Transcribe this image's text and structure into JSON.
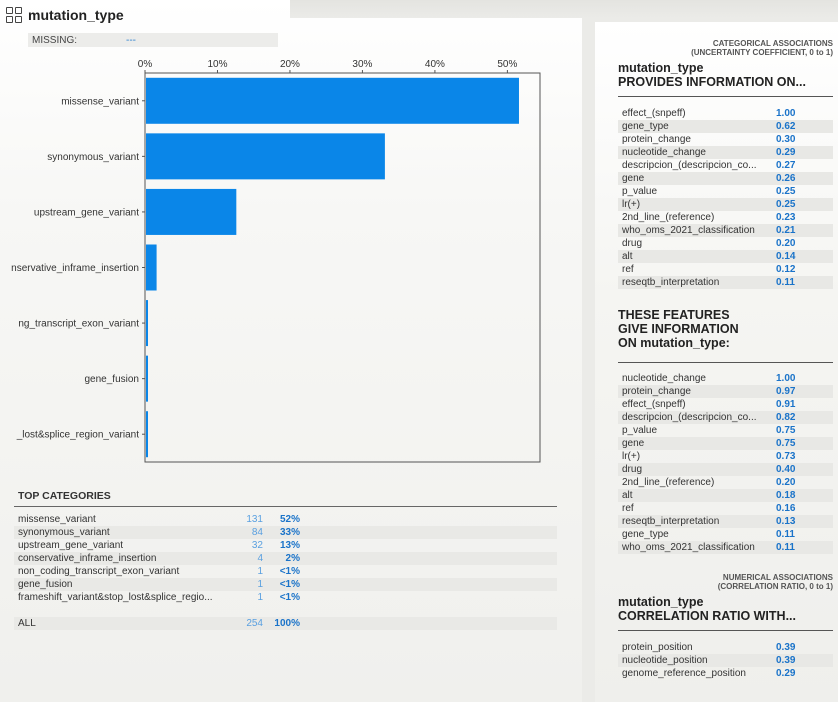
{
  "title": "mutation_type",
  "missing": {
    "label": "MISSING:",
    "value": "---"
  },
  "chart_data": {
    "type": "bar",
    "orientation": "horizontal",
    "categories": [
      "missense_variant",
      "synonymous_variant",
      "upstream_gene_variant",
      "conservative_inframe_insertion",
      "non_coding_transcript_exon_variant",
      "gene_fusion",
      "frameshift_variant&stop_lost&splice_region_variant"
    ],
    "category_labels_visible": [
      "missense_variant",
      "synonymous_variant",
      "upstream_gene_variant",
      "nservative_inframe_insertion",
      "ng_transcript_exon_variant",
      "gene_fusion",
      "_lost&splice_region_variant"
    ],
    "values": [
      51.6,
      33.1,
      12.6,
      1.6,
      0.4,
      0.4,
      0.4
    ],
    "xticks": [
      "0%",
      "10%",
      "20%",
      "30%",
      "40%",
      "50%"
    ],
    "xlim": [
      0,
      54.5
    ],
    "bar_color": "#0a86e8"
  },
  "top_categories": {
    "title": "TOP CATEGORIES",
    "rows": [
      {
        "name": "missense_variant",
        "count": "131",
        "pct": "52%"
      },
      {
        "name": "synonymous_variant",
        "count": "84",
        "pct": "33%"
      },
      {
        "name": "upstream_gene_variant",
        "count": "32",
        "pct": "13%"
      },
      {
        "name": "conservative_inframe_insertion",
        "count": "4",
        "pct": "2%"
      },
      {
        "name": "non_coding_transcript_exon_variant",
        "count": "1",
        "pct": "<1%"
      },
      {
        "name": "gene_fusion",
        "count": "1",
        "pct": "<1%"
      },
      {
        "name": "frameshift_variant&stop_lost&splice_regio...",
        "count": "1",
        "pct": "<1%"
      }
    ],
    "all": {
      "name": "ALL",
      "count": "254",
      "pct": "100%"
    }
  },
  "categorical": {
    "header1": "CATEGORICAL ASSOCIATIONS",
    "header2": "(UNCERTAINTY COEFFICIENT, 0 to 1)",
    "title1": "mutation_type",
    "title2": "PROVIDES INFORMATION ON...",
    "rows": [
      {
        "name": "effect_(snpeff)",
        "val": "1.00"
      },
      {
        "name": "gene_type",
        "val": "0.62"
      },
      {
        "name": "protein_change",
        "val": "0.30"
      },
      {
        "name": "nucleotide_change",
        "val": "0.29"
      },
      {
        "name": "descripcion_(descripcion_co...",
        "val": "0.27"
      },
      {
        "name": "gene",
        "val": "0.26"
      },
      {
        "name": "p_value",
        "val": "0.25"
      },
      {
        "name": "lr(+)",
        "val": "0.25"
      },
      {
        "name": "2nd_line_(reference)",
        "val": "0.23"
      },
      {
        "name": "who_oms_2021_classification",
        "val": "0.21"
      },
      {
        "name": "drug",
        "val": "0.20"
      },
      {
        "name": "alt",
        "val": "0.14"
      },
      {
        "name": "ref",
        "val": "0.12"
      },
      {
        "name": "reseqtb_interpretation",
        "val": "0.11"
      }
    ],
    "given_title1": "THESE FEATURES",
    "given_title2": "GIVE INFORMATION",
    "given_title3": "ON mutation_type:",
    "given_rows": [
      {
        "name": "nucleotide_change",
        "val": "1.00"
      },
      {
        "name": "protein_change",
        "val": "0.97"
      },
      {
        "name": "effect_(snpeff)",
        "val": "0.91"
      },
      {
        "name": "descripcion_(descripcion_co...",
        "val": "0.82"
      },
      {
        "name": "p_value",
        "val": "0.75"
      },
      {
        "name": "gene",
        "val": "0.75"
      },
      {
        "name": "lr(+)",
        "val": "0.73"
      },
      {
        "name": "drug",
        "val": "0.40"
      },
      {
        "name": "2nd_line_(reference)",
        "val": "0.20"
      },
      {
        "name": "alt",
        "val": "0.18"
      },
      {
        "name": "ref",
        "val": "0.16"
      },
      {
        "name": "reseqtb_interpretation",
        "val": "0.13"
      },
      {
        "name": "gene_type",
        "val": "0.11"
      },
      {
        "name": "who_oms_2021_classification",
        "val": "0.11"
      }
    ]
  },
  "numerical": {
    "header1": "NUMERICAL ASSOCIATIONS",
    "header2": "(CORRELATION RATIO, 0 to 1)",
    "title1": "mutation_type",
    "title2": "CORRELATION RATIO WITH...",
    "rows": [
      {
        "name": "protein_position",
        "val": "0.39"
      },
      {
        "name": "nucleotide_position",
        "val": "0.39"
      },
      {
        "name": "genome_reference_position",
        "val": "0.29"
      }
    ]
  }
}
